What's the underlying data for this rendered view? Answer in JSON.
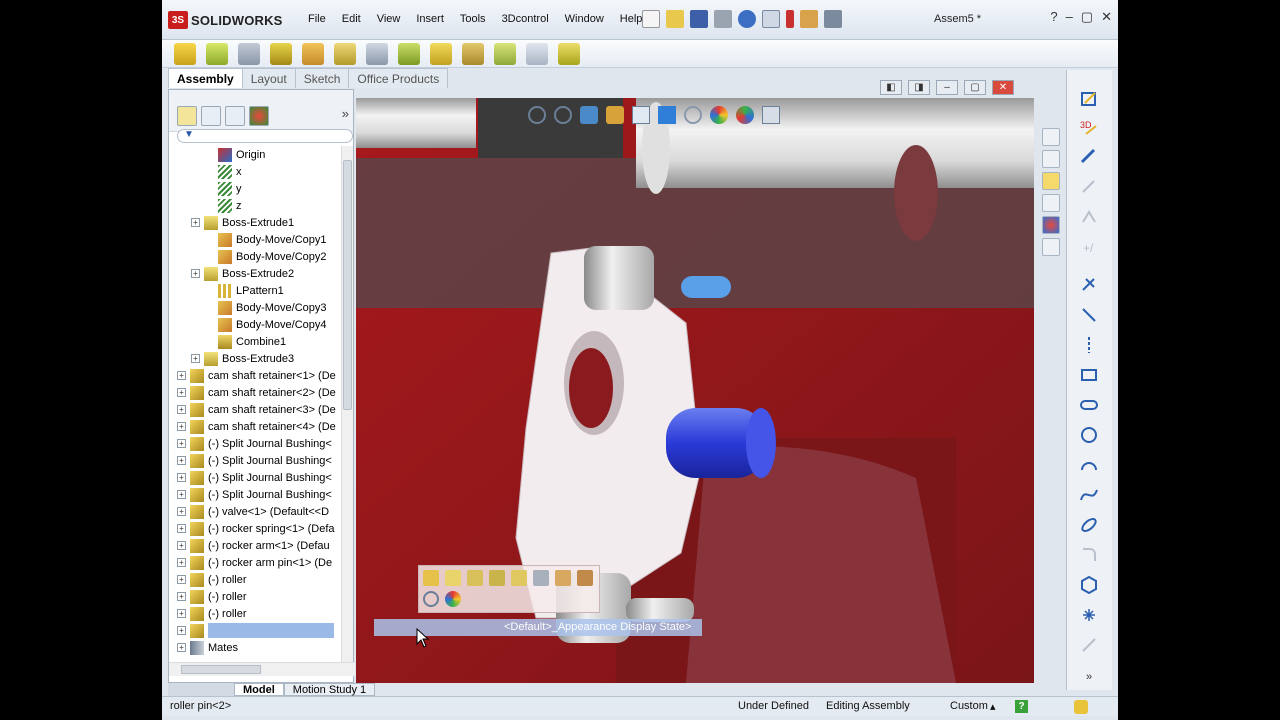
{
  "window": {
    "brand_prefix": "3S",
    "brand": "SOLIDWORKS",
    "document_title": "Assem5 *",
    "menu": [
      "File",
      "Edit",
      "View",
      "Insert",
      "Tools",
      "3Dcontrol",
      "Window",
      "Help"
    ]
  },
  "command_tabs": [
    "Assembly",
    "Layout",
    "Sketch",
    "Office Products"
  ],
  "feature_tree": {
    "items": [
      {
        "label": "Origin",
        "indent": 2,
        "icon": "origin-icon",
        "expandable": false
      },
      {
        "label": "x",
        "indent": 2,
        "icon": "axis-icon",
        "expandable": false
      },
      {
        "label": "y",
        "indent": 2,
        "icon": "axis-icon",
        "expandable": false
      },
      {
        "label": "z",
        "indent": 2,
        "icon": "axis-icon",
        "expandable": false
      },
      {
        "label": "Boss-Extrude1",
        "indent": 1,
        "icon": "extrude-icon",
        "expandable": true
      },
      {
        "label": "Body-Move/Copy1",
        "indent": 2,
        "icon": "move-body-icon",
        "expandable": false
      },
      {
        "label": "Body-Move/Copy2",
        "indent": 2,
        "icon": "move-body-icon",
        "expandable": false
      },
      {
        "label": "Boss-Extrude2",
        "indent": 1,
        "icon": "extrude-icon",
        "expandable": true
      },
      {
        "label": "LPattern1",
        "indent": 2,
        "icon": "pattern-icon",
        "expandable": false
      },
      {
        "label": "Body-Move/Copy3",
        "indent": 2,
        "icon": "move-body-icon",
        "expandable": false
      },
      {
        "label": "Body-Move/Copy4",
        "indent": 2,
        "icon": "move-body-icon",
        "expandable": false
      },
      {
        "label": "Combine1",
        "indent": 2,
        "icon": "combine-icon",
        "expandable": false
      },
      {
        "label": "Boss-Extrude3",
        "indent": 1,
        "icon": "extrude-icon",
        "expandable": true
      },
      {
        "label": "cam shaft retainer<1> (De",
        "indent": 0,
        "icon": "part-icon",
        "expandable": true
      },
      {
        "label": "cam shaft retainer<2> (De",
        "indent": 0,
        "icon": "part-icon",
        "expandable": true
      },
      {
        "label": "cam shaft retainer<3> (De",
        "indent": 0,
        "icon": "part-icon",
        "expandable": true
      },
      {
        "label": "cam shaft retainer<4> (De",
        "indent": 0,
        "icon": "part-icon",
        "expandable": true
      },
      {
        "label": "(-) Split Journal Bushing<",
        "indent": 0,
        "icon": "part-icon",
        "expandable": true
      },
      {
        "label": "(-) Split Journal Bushing<",
        "indent": 0,
        "icon": "part-icon",
        "expandable": true
      },
      {
        "label": "(-) Split Journal Bushing<",
        "indent": 0,
        "icon": "part-icon",
        "expandable": true
      },
      {
        "label": "(-) Split Journal Bushing<",
        "indent": 0,
        "icon": "part-icon",
        "expandable": true
      },
      {
        "label": "(-) valve<1> (Default<<D",
        "indent": 0,
        "icon": "part-icon",
        "expandable": true
      },
      {
        "label": "(-) rocker spring<1> (Defa",
        "indent": 0,
        "icon": "part-icon",
        "expandable": true
      },
      {
        "label": "(-) rocker arm<1> (Defau",
        "indent": 0,
        "icon": "part-icon",
        "expandable": true
      },
      {
        "label": "(-) rocker arm pin<1> (De",
        "indent": 0,
        "icon": "part-icon",
        "expandable": true
      },
      {
        "label": "(-) roller",
        "indent": 0,
        "icon": "part-icon",
        "expandable": true
      },
      {
        "label": "(-) roller",
        "indent": 0,
        "icon": "part-icon",
        "expandable": true
      },
      {
        "label": "(-) roller",
        "indent": 0,
        "icon": "part-icon",
        "expandable": true
      },
      {
        "label": "",
        "indent": 0,
        "icon": "part-icon",
        "expandable": true,
        "selected": true
      },
      {
        "label": "Mates",
        "indent": 0,
        "icon": "mates-icon",
        "expandable": true
      }
    ]
  },
  "tooltip": {
    "text": "<Default>_Appearance Display State>"
  },
  "bottom_tabs": [
    "Model",
    "Motion Study 1"
  ],
  "status_bar": {
    "selection": "roller pin<2>",
    "state": "Under Defined",
    "mode": "Editing Assembly",
    "units": "Custom",
    "help": "?"
  },
  "colors": {
    "accent_red": "#c81e1e",
    "model_red": "#8b1a1e",
    "selection_blue": "#9ab9e6"
  }
}
